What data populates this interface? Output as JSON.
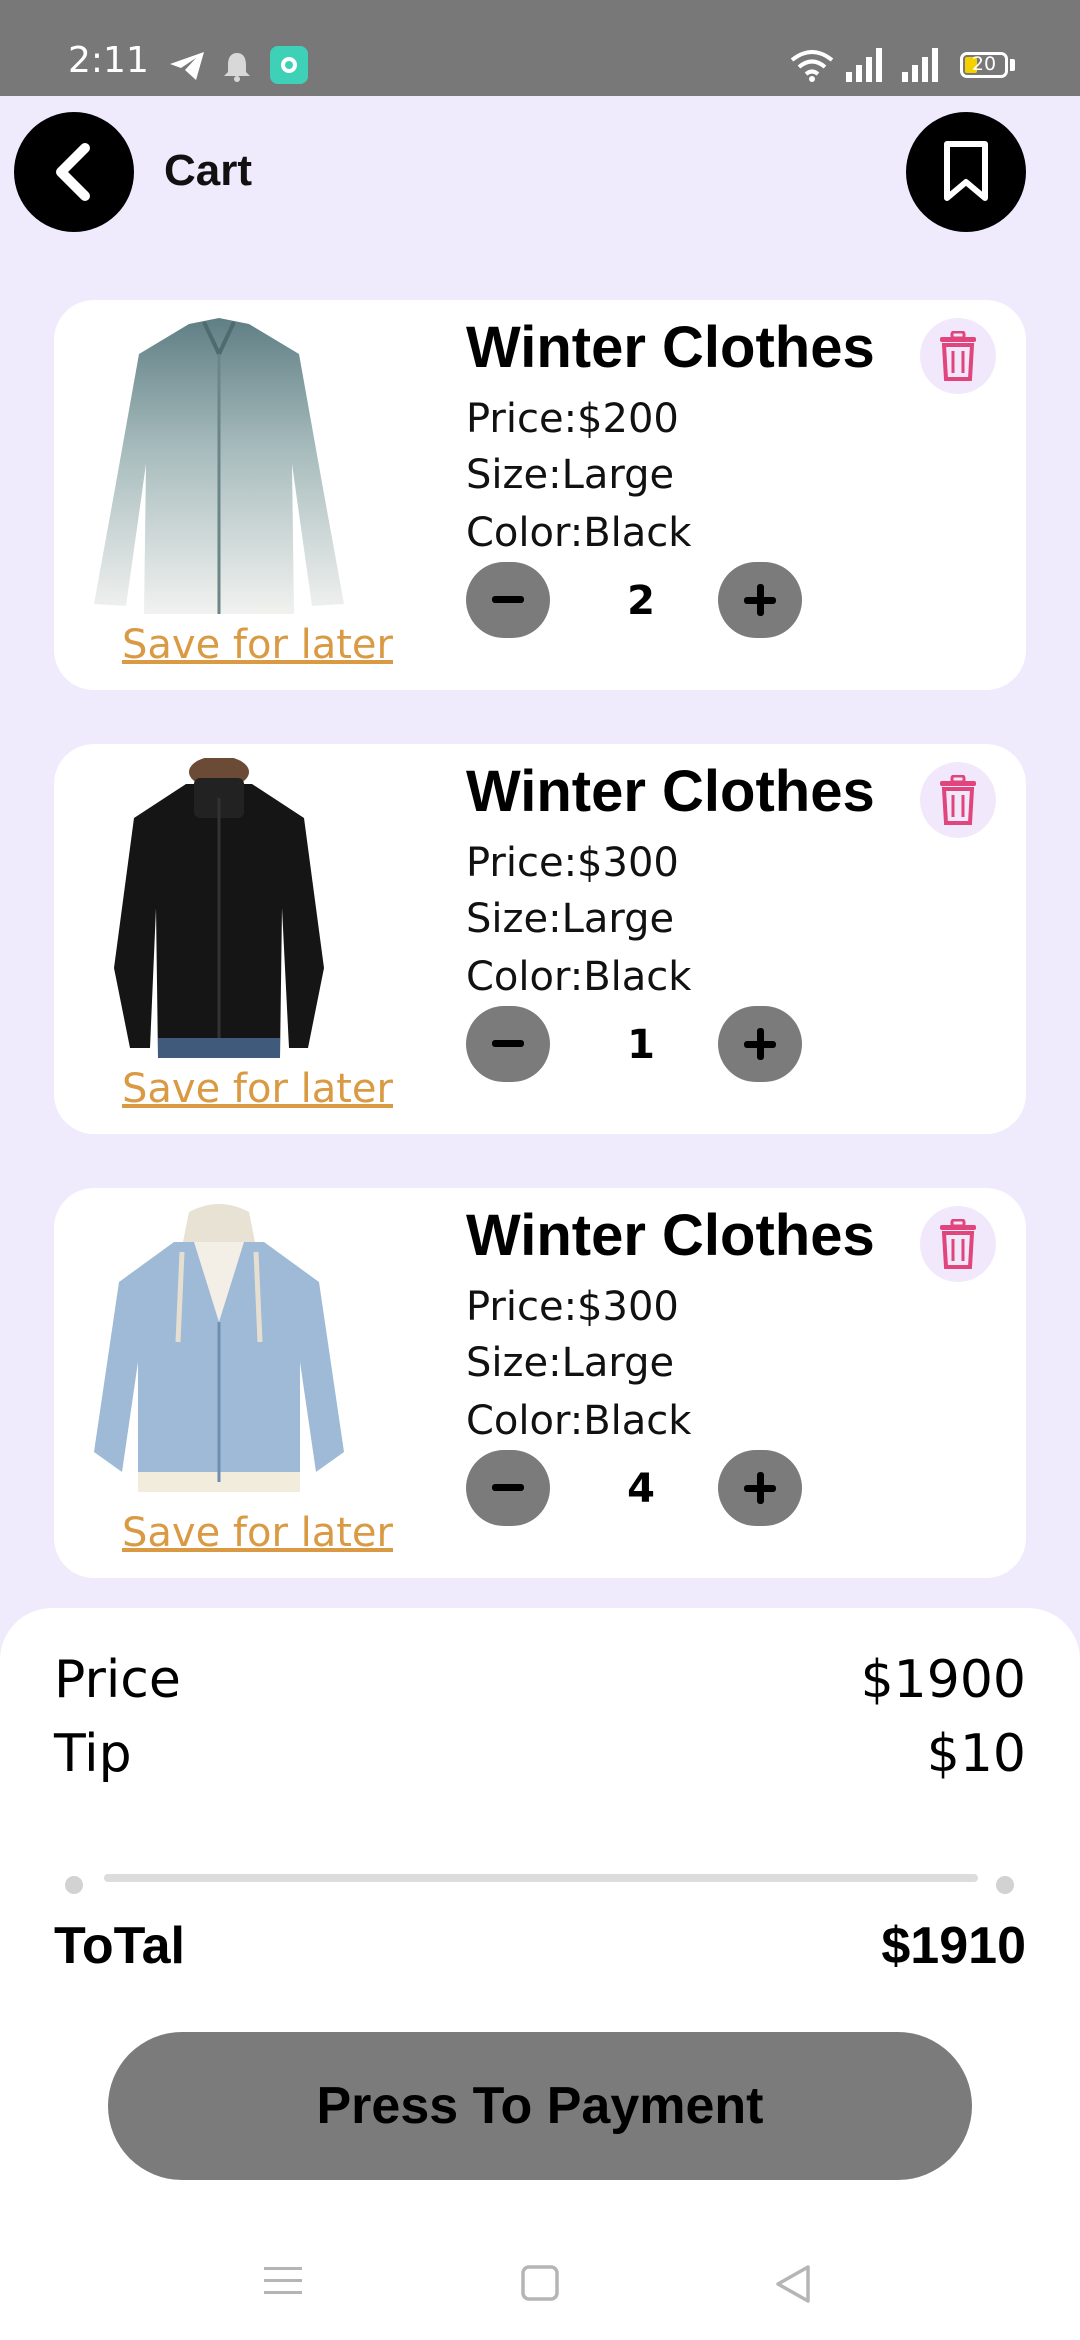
{
  "status_bar": {
    "time": "2:11",
    "battery": "20",
    "icons": [
      "telegram-icon",
      "bell-icon",
      "app-icon",
      "wifi-icon",
      "signal-icon",
      "signal-icon",
      "battery-icon"
    ]
  },
  "header": {
    "title": "Cart",
    "icons": [
      "back-arrow-icon",
      "bookmark-icon"
    ]
  },
  "cart": {
    "items": [
      {
        "title": "Winter Clothes",
        "price": "Price:$200",
        "size": "Size:Large",
        "color": "Color:Black",
        "quantity": "2",
        "save_label": "Save for later",
        "image": "light-shirt"
      },
      {
        "title": "Winter Clothes",
        "price": "Price:$300",
        "size": "Size:Large",
        "color": "Color:Black",
        "quantity": "1",
        "save_label": "Save for later",
        "image": "black-jacket"
      },
      {
        "title": "Winter Clothes",
        "price": "Price:$300",
        "size": "Size:Large",
        "color": "Color:Black",
        "quantity": "4",
        "save_label": "Save for later",
        "image": "denim-jacket"
      }
    ]
  },
  "summary": {
    "price_label": "Price",
    "price_value": "$1900",
    "tip_label": "Tip",
    "tip_value": "$10",
    "total_label": "ToTal",
    "total_value": "$1910",
    "pay_label": "Press To Payment"
  },
  "colors": {
    "background": "#efebfd",
    "accent_link": "#d99a43",
    "trash": "#e0457b",
    "button_gray": "#7b7b7b"
  }
}
